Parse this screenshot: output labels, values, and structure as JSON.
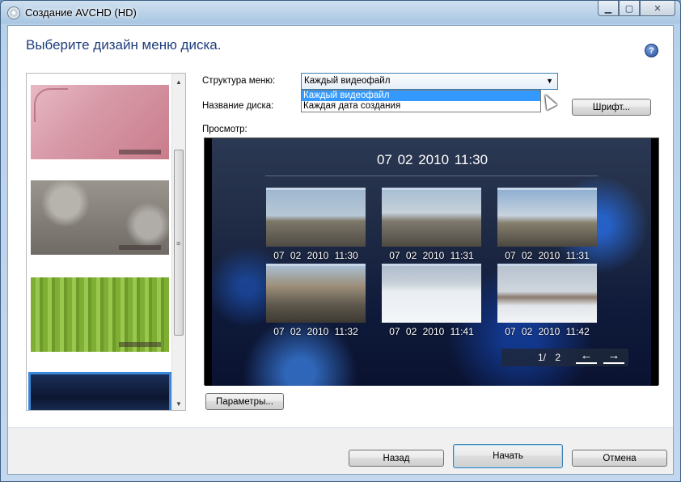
{
  "window": {
    "title": "Создание AVCHD (HD)",
    "help_glyph": "?",
    "min_glyph": "▁",
    "max_glyph": "▢",
    "close_glyph": "✕"
  },
  "heading": "Выберите дизайн меню диска.",
  "themes": {
    "items": [
      "pink-floral",
      "gray-bokeh",
      "green-stripes",
      "blue-night"
    ],
    "selected_index": 3,
    "scroll_up": "▲",
    "scroll_down": "▼",
    "grip": "≡"
  },
  "form": {
    "menu_structure_label": "Структура меню:",
    "menu_structure_value": "Каждый видеофайл",
    "menu_structure_options": [
      "Каждый видеофайл",
      "Каждая дата создания"
    ],
    "disc_name_label": "Название диска:",
    "font_button": "Шрифт...",
    "preview_label": "Просмотр:",
    "params_button": "Параметры..."
  },
  "preview": {
    "title": "07 02 2010  11:30",
    "clips": [
      "07 02 2010  11:30",
      "07 02 2010  11:31",
      "07 02 2010  11:31",
      "07 02 2010  11:32",
      "07 02 2010  11:41",
      "07 02 2010  11:42"
    ],
    "pager": "1/  2",
    "prev": "←",
    "next": "→"
  },
  "footer": {
    "back": "Назад",
    "start": "Начать",
    "cancel": "Отмена"
  }
}
